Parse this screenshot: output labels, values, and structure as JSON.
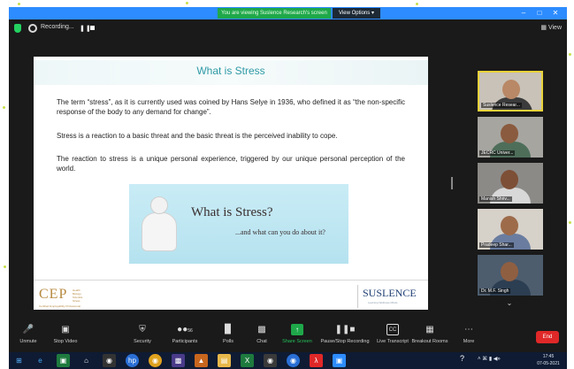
{
  "window": {
    "share_banner": "You are viewing Suslence Research's screen",
    "view_options": "View Options ▾",
    "minimize": "–",
    "maximize": "□",
    "close": "✕"
  },
  "meeting_bar": {
    "recording_label": "Recording...",
    "pause_icon": "pause-icon",
    "stop_icon": "stop-icon",
    "view_label": "View"
  },
  "slide": {
    "title": "What is Stress",
    "paragraphs": [
      "The term “stress”, as it is currently used was coined by Hans Selye in 1936, who defined it as “the non-specific response of the body to any demand for change”.",
      "Stress is a reaction to a basic threat and the basic threat is the perceived inability to cope.",
      "The reaction to stress is a unique personal experience, triggered by our unique personal perception of the world."
    ],
    "banner_title": "What is Stress?",
    "banner_subtitle": "...and what can you do about it?",
    "footer_left_logo": "CEP",
    "footer_left_lines": [
      "Health",
      "Biology",
      "Scientist",
      "Stress"
    ],
    "footer_left_tagline": "Certified Employability Professional",
    "footer_right_logo": "SUSLENCE",
    "footer_right_tagline": "Learning Wellness Minds"
  },
  "participants": [
    {
      "name": "Suslence Resear...",
      "active": true,
      "bg": "#c9c2b8",
      "skin": "#b98866",
      "shirt": "#3b3b3b"
    },
    {
      "name": "JECRC Univer...",
      "active": false,
      "bg": "#a7a5a0",
      "skin": "#8a5b3e",
      "shirt": "#4e6e5a"
    },
    {
      "name": "Manish Shriv...",
      "active": false,
      "bg": "#8c8a87",
      "skin": "#7d4f36",
      "shirt": "#d8d8d8"
    },
    {
      "name": "Pradeep Shar...",
      "active": false,
      "bg": "#d6d1c9",
      "skin": "#9d6b4a",
      "shirt": "#6a7da0"
    },
    {
      "name": "Dr. M.F. Singh",
      "active": false,
      "bg": "#4d5d6e",
      "skin": "#8f5f42",
      "shirt": "#2c3e52"
    }
  ],
  "gallery_scroll": "⌄",
  "toolbar": {
    "unmute": "Unmute",
    "stop_video": "Stop Video",
    "security": "Security",
    "participants": "Participants",
    "participants_count": "56",
    "polls": "Polls",
    "chat": "Chat",
    "share_screen": "Share Screen",
    "pause_stop_recording": "Pause/Stop Recording",
    "live_transcript": "Live Transcript",
    "live_transcript_icon_text": "CC",
    "breakout_rooms": "Breakout Rooms",
    "more": "More",
    "end": "End"
  },
  "taskbar": {
    "apps": [
      "windows-start",
      "edge",
      "store",
      "home",
      "camera",
      "hp",
      "chrome",
      "word-art",
      "acrobat-like",
      "files",
      "excel",
      "zoom-like",
      "browser",
      "acrobat",
      "zoom"
    ],
    "tray_help": "?",
    "tray_icons": "˄ ⌘ ▮ ◀»",
    "time": "17:45",
    "date": "07-05-2021"
  },
  "colors": {
    "zoom_blue": "#2d8cff",
    "share_green": "#1fa84a",
    "slide_title": "#2e9aa6",
    "end_red": "#e02828",
    "taskbar": "#0f1b33"
  }
}
